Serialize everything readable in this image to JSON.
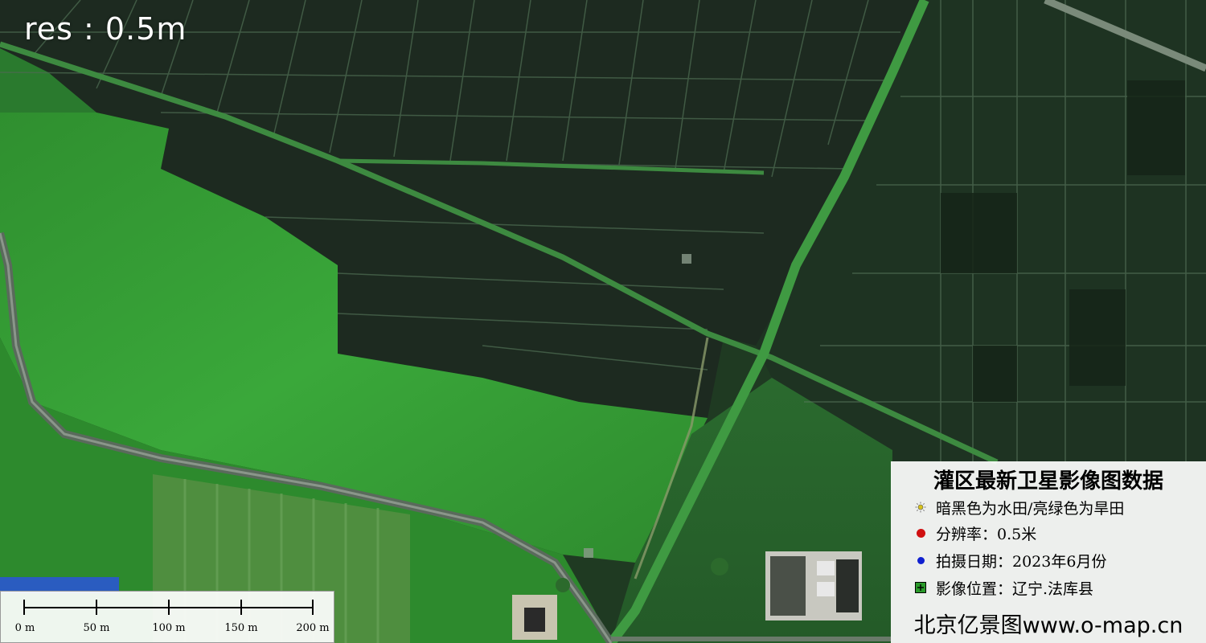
{
  "resolution_label": "res : 0.5m",
  "scale_bar": {
    "labels": [
      "0 m",
      "50 m",
      "100 m",
      "150 m",
      "200 m"
    ]
  },
  "legend": {
    "title": "灌区最新卫星影像图数据",
    "items": [
      {
        "icon": "sun-icon",
        "color": "#d8c21a",
        "text": "暗黑色为水田/亮绿色为旱田"
      },
      {
        "icon": "red-dot-icon",
        "color": "#d01010",
        "text": "分辨率：0.5米"
      },
      {
        "icon": "blue-dot-icon",
        "color": "#1020d0",
        "text": "拍摄日期：2023年6月份"
      },
      {
        "icon": "green-plus-box-icon",
        "color": "#2a9a2a",
        "text": "影像位置：辽宁.法库县"
      }
    ],
    "footer": "北京亿景图www.o-map.cn"
  },
  "colors": {
    "paddy_dark": "#1c2a1e",
    "dry_field_bright": "#2f9a2f",
    "road": "#6a7a6a",
    "canal": "#3a7a3a"
  }
}
